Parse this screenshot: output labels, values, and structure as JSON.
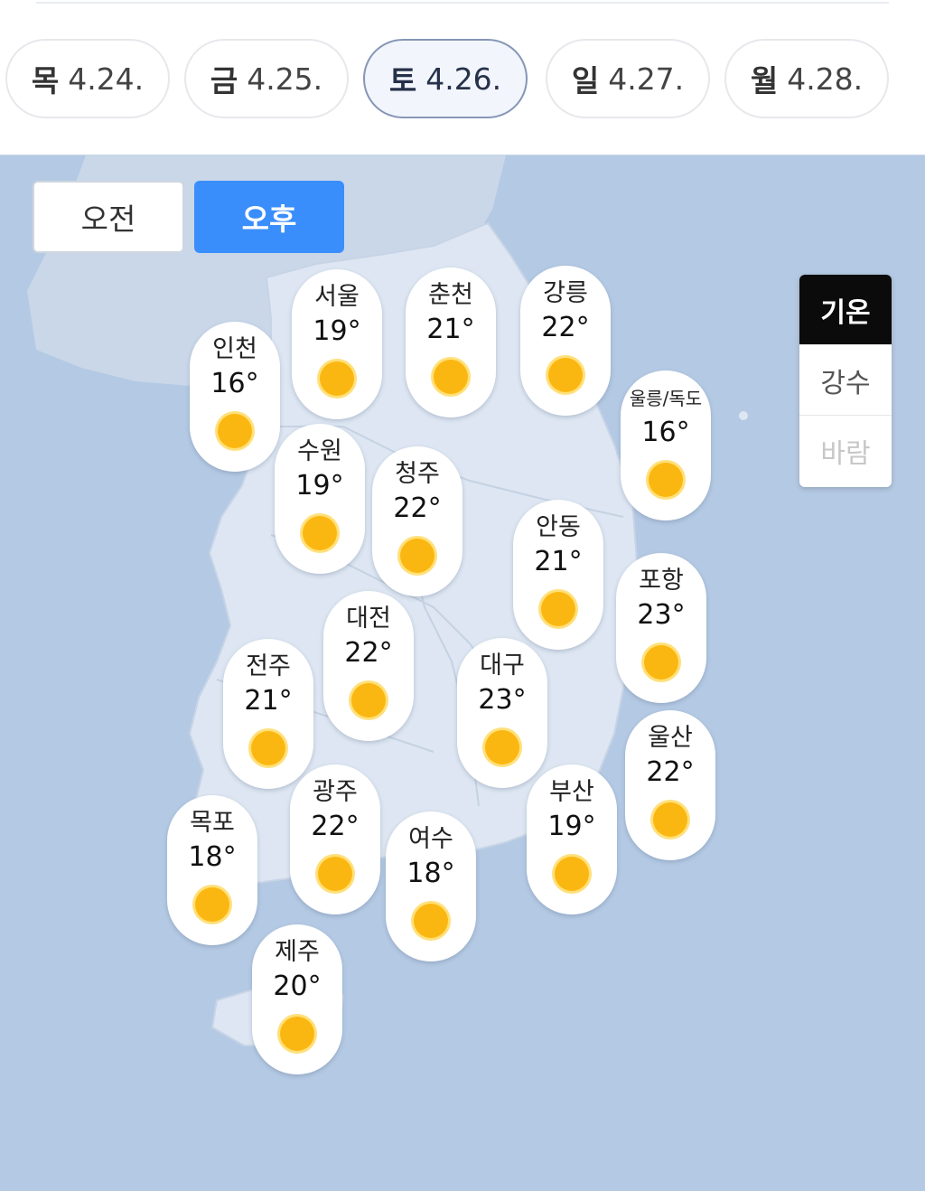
{
  "dates": [
    {
      "dow": "목",
      "date": "4.24."
    },
    {
      "dow": "금",
      "date": "4.25."
    },
    {
      "dow": "토",
      "date": "4.26."
    },
    {
      "dow": "일",
      "date": "4.27."
    },
    {
      "dow": "월",
      "date": "4.28."
    }
  ],
  "selected_date_index": 2,
  "time_toggle": {
    "am": "오전",
    "pm": "오후",
    "selected": "pm"
  },
  "layers": {
    "temperature": "기온",
    "precipitation": "강수",
    "wind": "바람",
    "selected": "temperature"
  },
  "weather_icon": "sun-icon",
  "colors": {
    "active_blue": "#3a8efc",
    "map_land": "#dde6f2",
    "map_sea": "#b4c9e3",
    "sun": "#fbb711"
  },
  "cities": [
    {
      "name": "인천",
      "temp": "16°"
    },
    {
      "name": "서울",
      "temp": "19°"
    },
    {
      "name": "춘천",
      "temp": "21°"
    },
    {
      "name": "강릉",
      "temp": "22°"
    },
    {
      "name": "울릉/독도",
      "temp": "16°"
    },
    {
      "name": "수원",
      "temp": "19°"
    },
    {
      "name": "청주",
      "temp": "22°"
    },
    {
      "name": "안동",
      "temp": "21°"
    },
    {
      "name": "포항",
      "temp": "23°"
    },
    {
      "name": "대전",
      "temp": "22°"
    },
    {
      "name": "전주",
      "temp": "21°"
    },
    {
      "name": "대구",
      "temp": "23°"
    },
    {
      "name": "울산",
      "temp": "22°"
    },
    {
      "name": "광주",
      "temp": "22°"
    },
    {
      "name": "부산",
      "temp": "19°"
    },
    {
      "name": "목포",
      "temp": "18°"
    },
    {
      "name": "여수",
      "temp": "18°"
    },
    {
      "name": "제주",
      "temp": "20°"
    }
  ]
}
